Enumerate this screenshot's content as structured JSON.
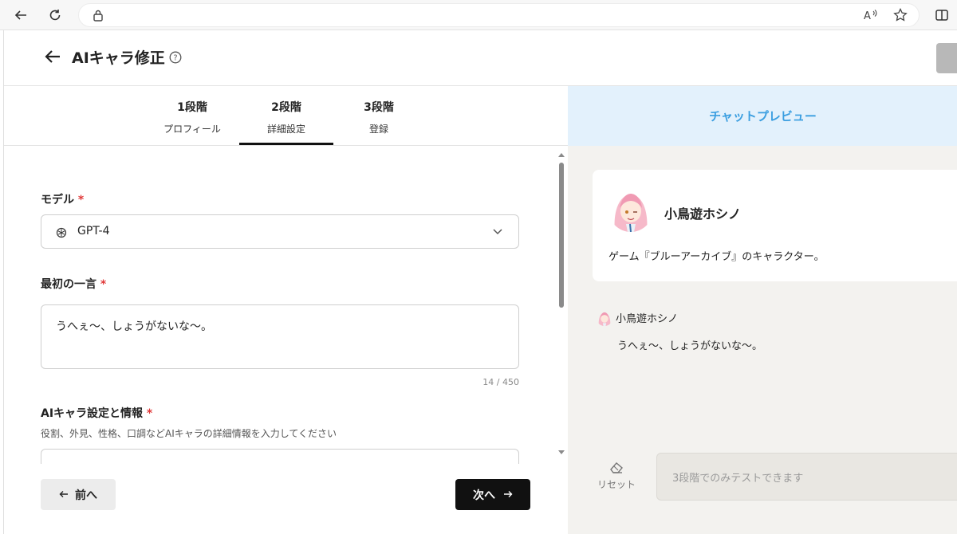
{
  "header": {
    "title": "AIキャラ修正"
  },
  "steps": [
    {
      "number": "1段階",
      "name": "プロフィール",
      "active": false
    },
    {
      "number": "2段階",
      "name": "詳細設定",
      "active": true
    },
    {
      "number": "3段階",
      "name": "登録",
      "active": false
    }
  ],
  "form": {
    "model_label": "モデル",
    "model_value": "GPT-4",
    "first_line_label": "最初の一言",
    "first_line_value": "うへぇ〜、しょうがないな〜。",
    "first_line_counter": "14 / 450",
    "settings_label": "AIキャラ設定と情報",
    "settings_hint": "役割、外見、性格、口調などAIキャラの詳細情報を入力してください",
    "required_mark": "*"
  },
  "footer": {
    "prev_label": "前へ",
    "next_label": "次へ"
  },
  "preview": {
    "title": "チャットプレビュー",
    "character_name": "小鳥遊ホシノ",
    "character_description": "ゲーム『ブルーアーカイブ』のキャラクター。",
    "message_sender": "小鳥遊ホシノ",
    "message_text": "うへぇ〜、しょうがないな〜。",
    "reset_label": "リセット",
    "input_placeholder": "3段階でのみテストできます"
  },
  "colors": {
    "accent_blue": "#3a9ee0",
    "preview_header_bg": "#e3f1fc",
    "required_red": "#e03838",
    "primary_button": "#111111"
  }
}
